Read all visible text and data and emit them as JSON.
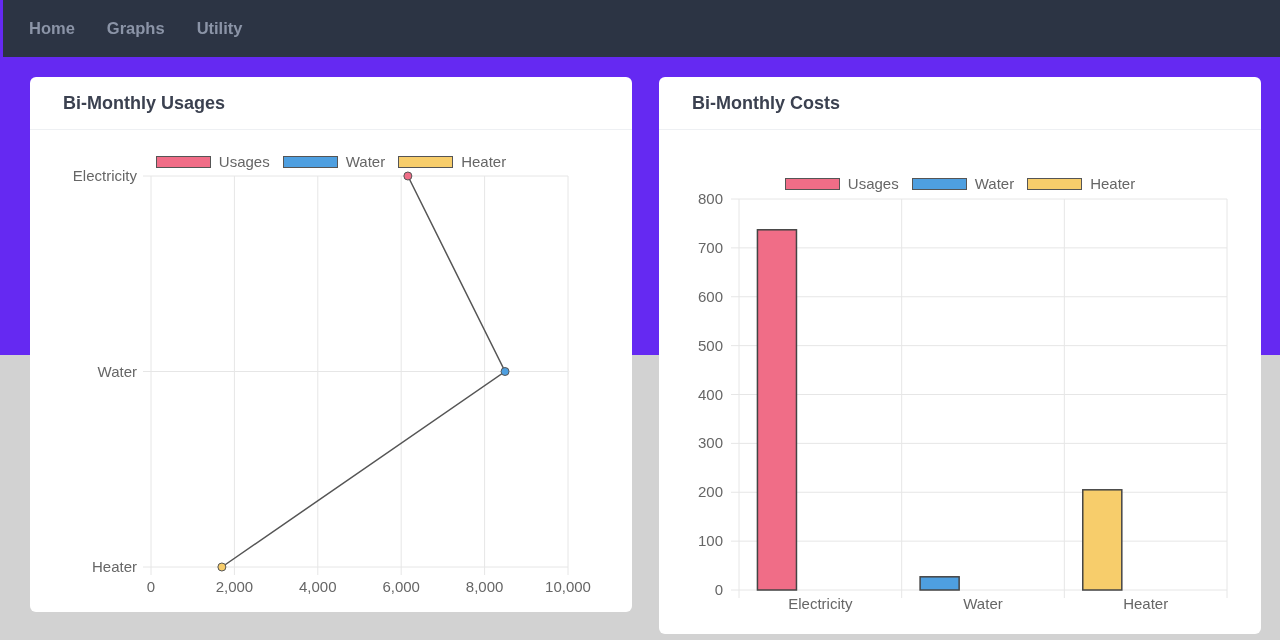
{
  "navbar": {
    "links": [
      {
        "label": "Home"
      },
      {
        "label": "Graphs"
      },
      {
        "label": "Utility"
      }
    ]
  },
  "cards": [
    {
      "title": "Bi-Monthly Usages",
      "chart_data": {
        "type": "line",
        "orientation": "horizontal",
        "grid": true,
        "categories": [
          "Electricity",
          "Water",
          "Heater"
        ],
        "series": [
          {
            "name": "Usages",
            "color": "#f06d87",
            "marker": "circle",
            "values": [
              6160,
              null,
              null
            ]
          },
          {
            "name": "Water",
            "color": "#4e9fe0",
            "marker": "circle",
            "values": [
              null,
              8490,
              null
            ]
          },
          {
            "name": "Heater",
            "color": "#f7cd6b",
            "marker": "circle",
            "values": [
              null,
              null,
              1700
            ]
          },
          {
            "color": "#555555",
            "values": [
              6160,
              8490,
              1700
            ]
          }
        ],
        "xlim": [
          0,
          10000
        ],
        "xticks": [
          {
            "value": 0,
            "label": "0"
          },
          {
            "value": 2000,
            "label": "2,000"
          },
          {
            "value": 4000,
            "label": "4,000"
          },
          {
            "value": 6000,
            "label": "6,000"
          },
          {
            "value": 8000,
            "label": "8,000"
          },
          {
            "value": 10000,
            "label": "10,000"
          }
        ]
      }
    },
    {
      "title": "Bi-Monthly Costs",
      "chart_data": {
        "type": "bar",
        "orientation": "vertical",
        "grid": true,
        "categories": [
          "Electricity",
          "Water",
          "Heater"
        ],
        "series": [
          {
            "name": "Usages",
            "color": "#f06d87",
            "values": [
              737,
              null,
              null
            ]
          },
          {
            "name": "Water",
            "color": "#4e9fe0",
            "values": [
              null,
              27,
              null
            ]
          },
          {
            "name": "Heater",
            "color": "#f7cd6b",
            "values": [
              null,
              null,
              205
            ]
          }
        ],
        "ylim": [
          0,
          800
        ],
        "yticks": [
          0,
          100,
          200,
          300,
          400,
          500,
          600,
          700,
          800
        ]
      }
    }
  ]
}
